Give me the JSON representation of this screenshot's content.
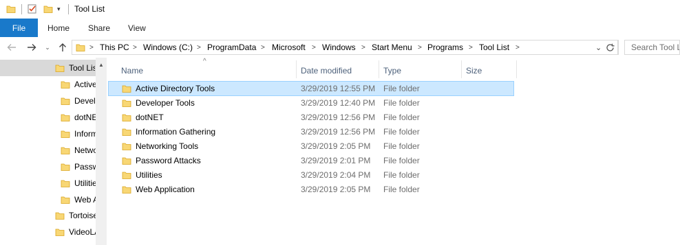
{
  "window": {
    "title": "Tool List"
  },
  "ribbon": {
    "file_label": "File",
    "tabs": [
      "Home",
      "Share",
      "View"
    ]
  },
  "address": {
    "crumbs": [
      "This PC",
      "Windows (C:)",
      "ProgramData",
      "Microsoft",
      "Windows",
      "Start Menu",
      "Programs",
      "Tool List"
    ]
  },
  "search": {
    "placeholder": "Search Tool List"
  },
  "navpane": {
    "items": [
      "Tool List",
      "Active Directory Tools",
      "Developer Tools",
      "dotNET",
      "Information Gathering",
      "Networking Tools",
      "Password Attacks",
      "Utilities",
      "Web Application",
      "TortoiseSVN",
      "VideoLAN"
    ]
  },
  "columns": {
    "name": "Name",
    "date": "Date modified",
    "type": "Type",
    "size": "Size"
  },
  "files": [
    {
      "name": "Active Directory Tools",
      "date": "3/29/2019 12:55 PM",
      "type": "File folder",
      "size": ""
    },
    {
      "name": "Developer Tools",
      "date": "3/29/2019 12:40 PM",
      "type": "File folder",
      "size": ""
    },
    {
      "name": "dotNET",
      "date": "3/29/2019 12:56 PM",
      "type": "File folder",
      "size": ""
    },
    {
      "name": "Information Gathering",
      "date": "3/29/2019 12:56 PM",
      "type": "File folder",
      "size": ""
    },
    {
      "name": "Networking Tools",
      "date": "3/29/2019 2:05 PM",
      "type": "File folder",
      "size": ""
    },
    {
      "name": "Password Attacks",
      "date": "3/29/2019 2:01 PM",
      "type": "File folder",
      "size": ""
    },
    {
      "name": "Utilities",
      "date": "3/29/2019 2:04 PM",
      "type": "File folder",
      "size": ""
    },
    {
      "name": "Web Application",
      "date": "3/29/2019 2:05 PM",
      "type": "File folder",
      "size": ""
    }
  ],
  "icons": {
    "folder": "folder-icon",
    "back": "back-arrow-icon",
    "forward": "forward-arrow-icon",
    "up": "up-arrow-icon",
    "refresh": "refresh-icon"
  },
  "colors": {
    "accent": "#1979ca",
    "selection": "#cce8ff",
    "folder": "#f8d775"
  }
}
